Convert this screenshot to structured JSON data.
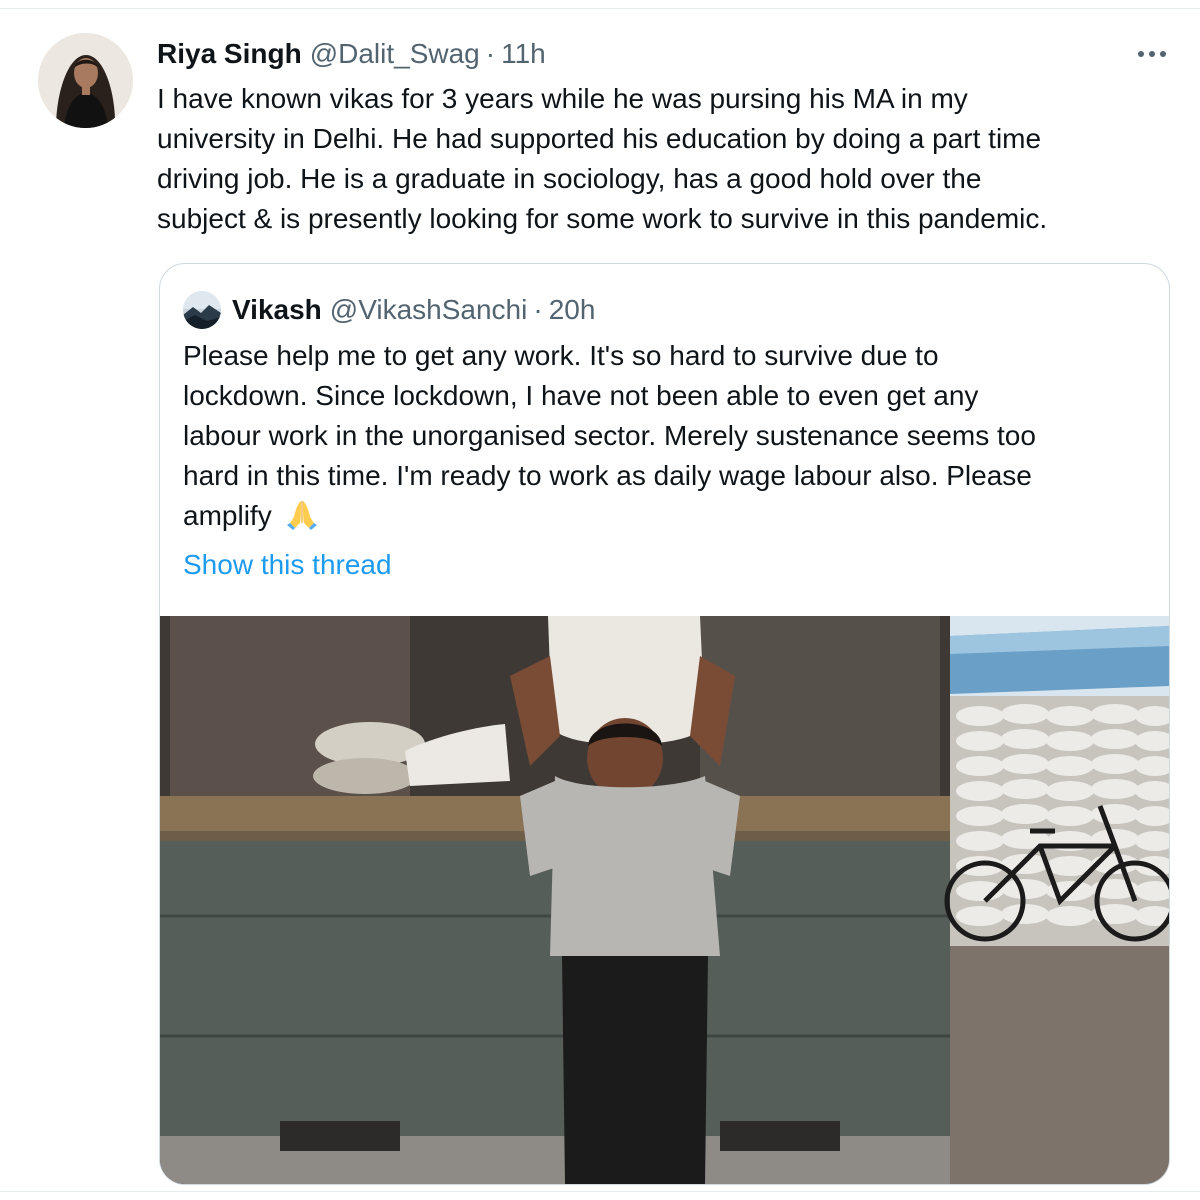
{
  "tweet": {
    "display_name": "Riya Singh",
    "handle": "@Dalit_Swag",
    "separator": "·",
    "time": "11h",
    "text_lines": [
      "I have known vikas for 3 years while he was pursing his MA in my",
      "university in Delhi. He had supported his education by doing a part time",
      "driving job. He is a graduate in sociology, has a good hold over the",
      "subject & is presently looking for some work to survive in this pandemic."
    ]
  },
  "quote": {
    "display_name": "Vikash",
    "handle": "@VikashSanchi",
    "separator": "·",
    "time": "20h",
    "text_lines": [
      "Please help me to get any work. It's so hard to survive due to",
      "lockdown. Since lockdown, I have not been able to even get any",
      "labour work in the unorganised sector. Merely sustenance seems too",
      "hard in this time. I'm ready to work as daily wage labour also. Please",
      "amplify"
    ],
    "emoji": "🙏",
    "show_thread": "Show this thread"
  },
  "icons": {
    "more": "more-horizontal-icon",
    "emoji": "folded-hands-icon"
  },
  "colors": {
    "link": "#1d9bf0",
    "secondary_text": "#536471",
    "primary_text": "#0f1419",
    "card_border": "#cfd9de"
  }
}
